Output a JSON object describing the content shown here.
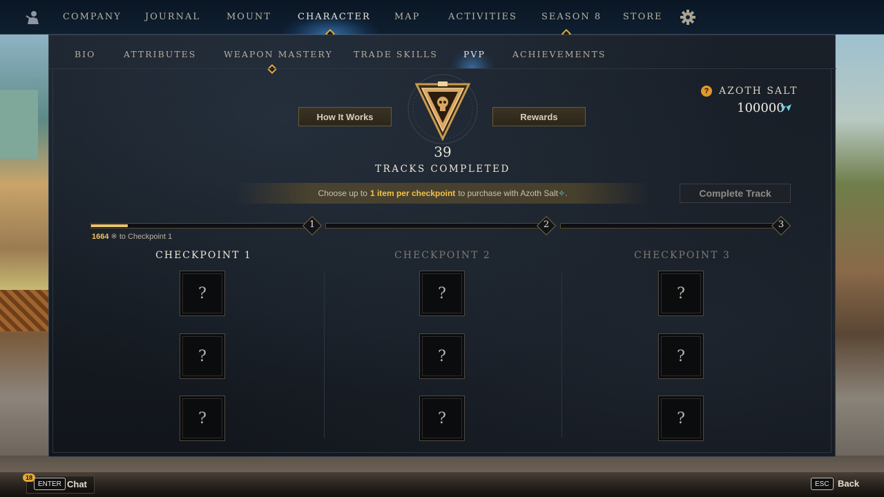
{
  "top_nav": {
    "items": [
      "COMPANY",
      "JOURNAL",
      "MOUNT",
      "CHARACTER",
      "MAP",
      "ACTIVITIES",
      "SEASON 8",
      "STORE"
    ],
    "active": "CHARACTER"
  },
  "sub_nav": {
    "items": [
      "BIO",
      "ATTRIBUTES",
      "WEAPON MASTERY",
      "TRADE SKILLS",
      "PVP",
      "ACHIEVEMENTS"
    ],
    "active": "PVP"
  },
  "buttons": {
    "how_it_works": "How It Works",
    "rewards": "Rewards",
    "complete_track": "Complete Track"
  },
  "tracks": {
    "completed_count": "39",
    "completed_label": "TRACKS COMPLETED"
  },
  "currency": {
    "label": "AZOTH SALT",
    "value": "100000",
    "help_icon": "?"
  },
  "banner": {
    "prefix": "Choose up to",
    "highlight": "1 item per checkpoint",
    "suffix": "to purchase with Azoth Salt"
  },
  "progress": {
    "amount": "1664",
    "suffix": "to Checkpoint 1",
    "fill_fraction": 0.17,
    "checkpoint_numbers": [
      "1",
      "2",
      "3"
    ]
  },
  "checkpoints": [
    {
      "title": "CHECKPOINT 1",
      "slots": [
        "?",
        "?",
        "?"
      ]
    },
    {
      "title": "CHECKPOINT 2",
      "slots": [
        "?",
        "?",
        "?"
      ]
    },
    {
      "title": "CHECKPOINT 3",
      "slots": [
        "?",
        "?",
        "?"
      ]
    }
  ],
  "bottom_bar": {
    "chat_key": "ENTER",
    "chat_label": "Chat",
    "chat_badge": "18",
    "back_key": "ESC",
    "back_label": "Back"
  },
  "colors": {
    "accent_gold": "#e3a93a",
    "highlight_yellow": "#f2c24a",
    "azoth_blue": "#6fd4e8",
    "nav_glow": "#50aaff"
  },
  "icons": [
    "player-icon",
    "gear-icon",
    "pvp-emblem-icon",
    "help-icon",
    "azoth-gem-icon"
  ]
}
